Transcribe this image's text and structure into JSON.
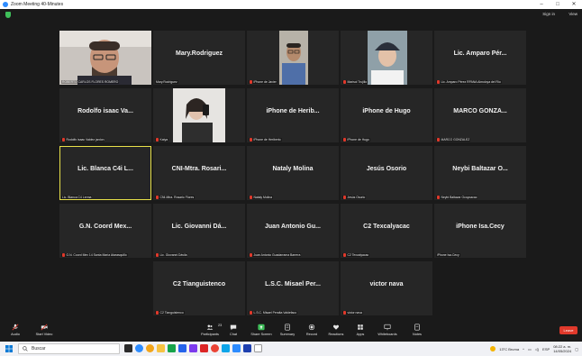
{
  "window": {
    "title": "Zoom Meeting 40-Minutes",
    "controls": [
      "–",
      "□",
      "✕"
    ]
  },
  "topbar": {
    "signin": "Sign in",
    "view": "View"
  },
  "participants": [
    {
      "name": "ROBERTO CARLOS FLORES ROMERO",
      "big": "",
      "video": "man-glasses",
      "muted": false,
      "label_prefix": "C2"
    },
    {
      "name": "Mary.Rodriguez",
      "big": "Mary.Rodriguez",
      "video": "",
      "muted": false
    },
    {
      "name": "iPhone de Javier",
      "big": "",
      "video": "man-shirt",
      "muted": true
    },
    {
      "name": "Marisol Trujillo",
      "big": "",
      "video": "woman-cap",
      "muted": true
    },
    {
      "name": "Lic. Amparo Pérez RPANA Almoloya del Río",
      "big": "Lic. Amparo Pér...",
      "video": "",
      "muted": true
    },
    {
      "name": "Rodolfo isaac Valdez jardon",
      "big": "Rodolfo isaac Va...",
      "video": "",
      "muted": true
    },
    {
      "name": "Katya",
      "big": "",
      "video": "woman-selfie",
      "muted": true
    },
    {
      "name": "iPhone de Heriberto",
      "big": "iPhone de Herib...",
      "video": "",
      "muted": true
    },
    {
      "name": "iPhone de Hugo",
      "big": "iPhone de Hugo",
      "video": "",
      "muted": true
    },
    {
      "name": "MARCO GONZALEZ",
      "big": "MARCO GONZA...",
      "video": "",
      "muted": true
    },
    {
      "name": "Lic. Blanca C4 Lerma",
      "big": "Lic. Blanca C4i L...",
      "video": "",
      "muted": false
    },
    {
      "name": "CNI-Mtra. Rosario Flores",
      "big": "CNI-Mtra. Rosari...",
      "video": "",
      "muted": true
    },
    {
      "name": "Nataly Molina",
      "big": "Nataly Molina",
      "video": "",
      "muted": true
    },
    {
      "name": "Jesús Osorio",
      "big": "Jesús Osorio",
      "video": "",
      "muted": true
    },
    {
      "name": "Neybi Baltazar Ocoyoacac",
      "big": "Neybi Baltazar O...",
      "video": "",
      "muted": true
    },
    {
      "name": "G.N. Coord Mex 14 Santa María Atarasquillo",
      "big": "G.N. Coord Mex...",
      "video": "",
      "muted": true
    },
    {
      "name": "Lic. Giovanni Dávila",
      "big": "Lic. Giovanni Dá...",
      "video": "",
      "muted": true
    },
    {
      "name": "Juan Antonio Guadarrama Barrera",
      "big": "Juan Antonio Gu...",
      "video": "",
      "muted": true
    },
    {
      "name": "C2 Texcalyacac",
      "big": "C2 Texcalyacac",
      "video": "",
      "muted": true
    },
    {
      "name": "iPhone Isa.Cecy",
      "big": "iPhone Isa.Cecy",
      "video": "",
      "muted": false
    },
    {
      "name": "C2 Tianguistenco",
      "big": "C2 Tianguistenco",
      "video": "",
      "muted": true
    },
    {
      "name": "L.S.C. Misael Peralta Valdefaco",
      "big": "L.S.C. Misael Per...",
      "video": "",
      "muted": true
    },
    {
      "name": "victor nava",
      "big": "victor nava",
      "video": "",
      "muted": true
    }
  ],
  "toolbar": {
    "audio": "Audio",
    "video": "Start Video",
    "participants": "Participants",
    "participants_count": "23",
    "chat": "Chat",
    "share": "Share Screen",
    "summary": "Summary",
    "record": "Record",
    "reactions": "Reactions",
    "apps": "Apps",
    "whiteboards": "Whiteboards",
    "notes": "Notes",
    "leave": "Leave"
  },
  "taskbar": {
    "search_placeholder": "Buscar",
    "weather": "13°C Bruma",
    "time": "08:22 a. m.",
    "date": "14/05/2024",
    "lang": "ESP"
  },
  "colors": {
    "accent": "#2d8cff",
    "active_speaker": "#e8e14a",
    "mute": "#e0392b",
    "share": "#3fbf5a",
    "leave": "#e0392b"
  }
}
